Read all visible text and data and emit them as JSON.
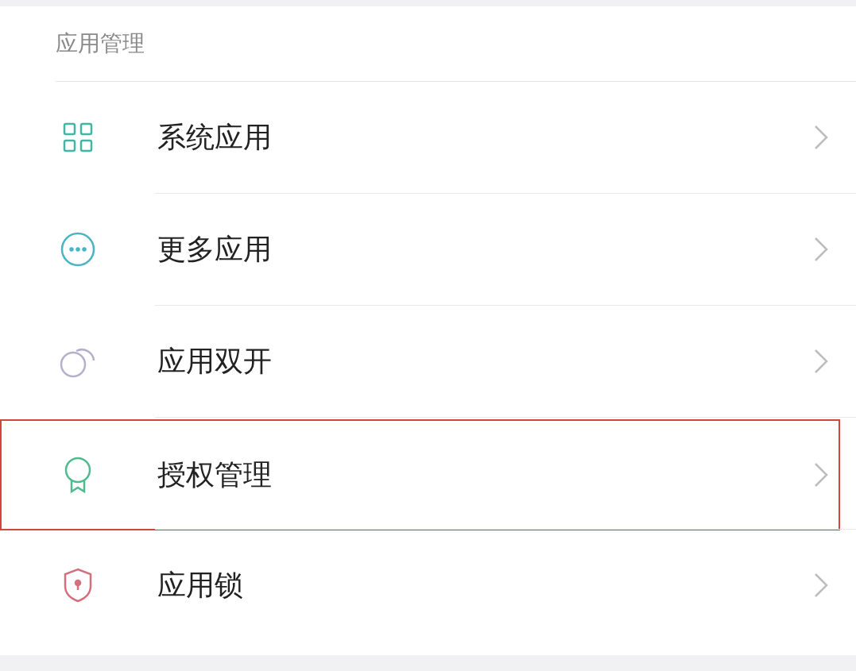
{
  "section_title": "应用管理",
  "items": [
    {
      "label": "系统应用",
      "kind": "grid",
      "color": "#45b5a3",
      "highlighted": false
    },
    {
      "label": "更多应用",
      "kind": "more",
      "color": "#4bb3c3",
      "highlighted": false
    },
    {
      "label": "应用双开",
      "kind": "dual",
      "color": "#b3b1c9",
      "highlighted": false
    },
    {
      "label": "授权管理",
      "kind": "badge",
      "color": "#4dbb8e",
      "highlighted": true
    },
    {
      "label": "应用锁",
      "kind": "shield",
      "color": "#d46f7e",
      "highlighted": false
    }
  ]
}
